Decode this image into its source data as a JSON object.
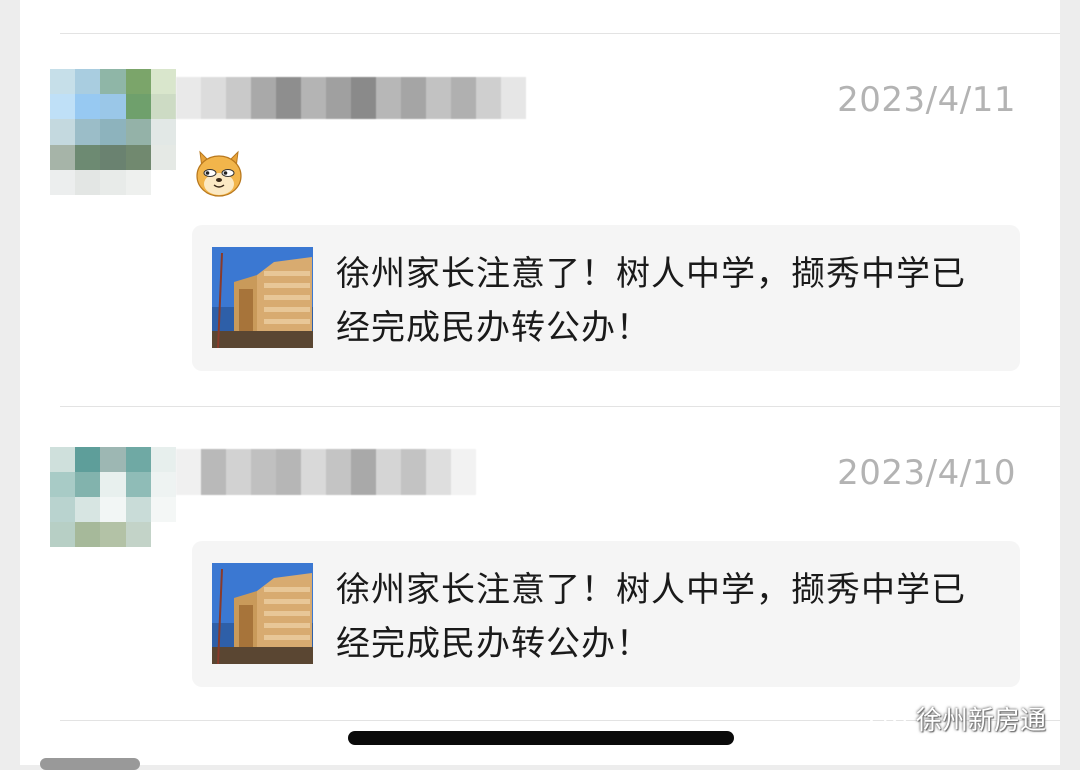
{
  "comments": [
    {
      "timestamp": "2023/4/11",
      "has_emoji": true,
      "emoji_icon": "doge-icon",
      "article_title": "徐州家长注意了！树人中学，撷秀中学已经完成民办转公办！"
    },
    {
      "timestamp": "2023/4/10",
      "has_emoji": false,
      "article_title": "徐州家长注意了！树人中学，撷秀中学已经完成民办转公办！"
    }
  ],
  "watermark": {
    "text": "徐州新房通",
    "icon": "wechat-icon"
  },
  "colors": {
    "background": "#ededed",
    "card": "#f5f5f5",
    "timestamp": "#b3b3b3"
  }
}
